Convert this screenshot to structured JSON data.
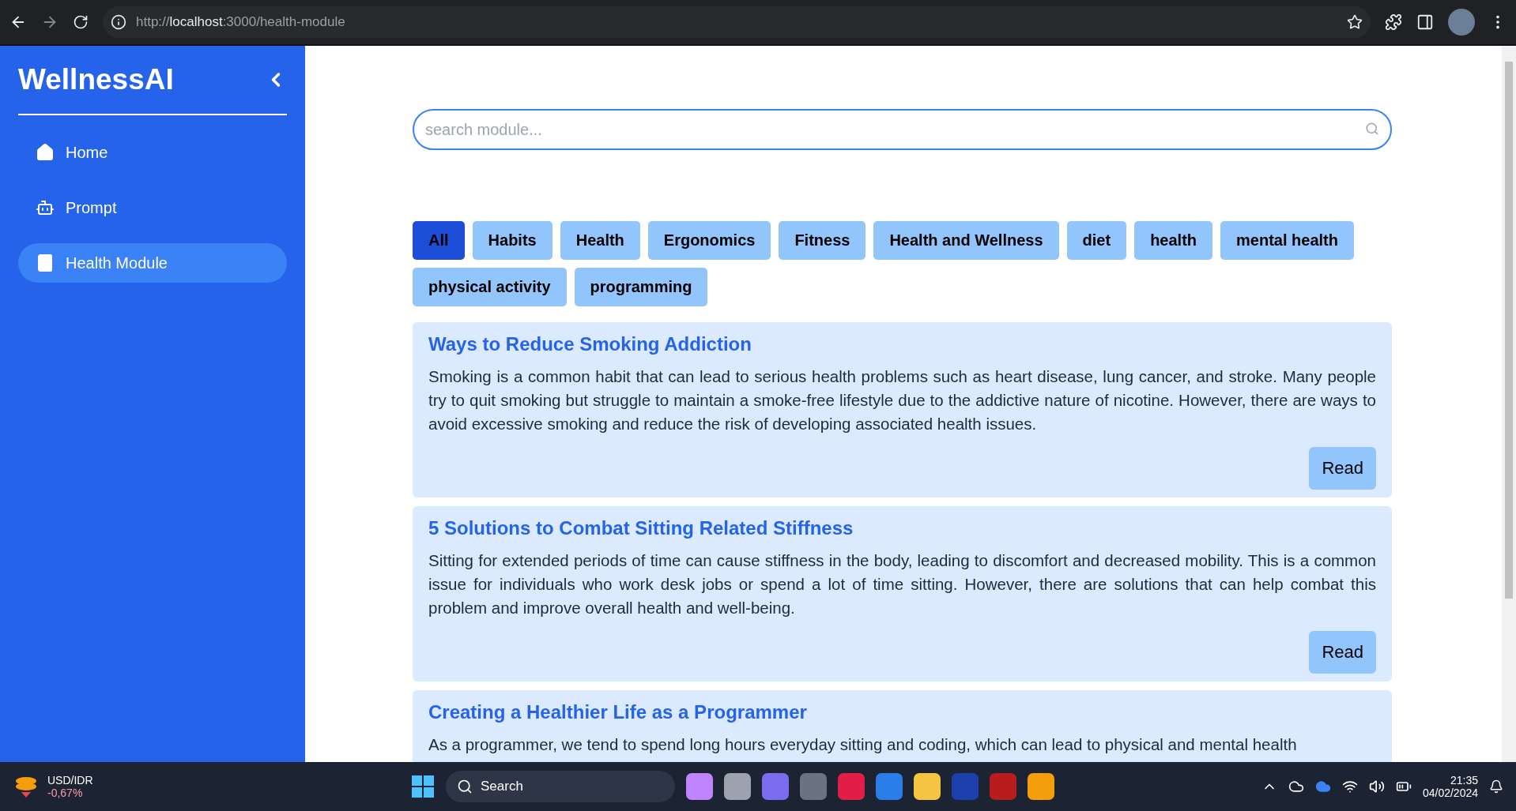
{
  "browser": {
    "url": {
      "scheme": "http://",
      "host": "localhost",
      "path": ":3000/health-module"
    }
  },
  "sidebar": {
    "title": "WellnessAI",
    "items": [
      {
        "label": "Home",
        "selected": false
      },
      {
        "label": "Prompt",
        "selected": false
      },
      {
        "label": "Health Module",
        "selected": true
      }
    ]
  },
  "search": {
    "placeholder": "search module..."
  },
  "tags": [
    {
      "label": "All",
      "selected": true
    },
    {
      "label": "Habits",
      "selected": false
    },
    {
      "label": "Health",
      "selected": false
    },
    {
      "label": "Ergonomics",
      "selected": false
    },
    {
      "label": "Fitness",
      "selected": false
    },
    {
      "label": "Health and Wellness",
      "selected": false
    },
    {
      "label": "diet",
      "selected": false
    },
    {
      "label": "health",
      "selected": false
    },
    {
      "label": "mental health",
      "selected": false
    },
    {
      "label": "physical activity",
      "selected": false
    },
    {
      "label": "programming",
      "selected": false
    }
  ],
  "modules": [
    {
      "title": "Ways to Reduce Smoking Addiction",
      "description": "Smoking is a common habit that can lead to serious health problems such as heart disease, lung cancer, and stroke. Many people try to quit smoking but struggle to maintain a smoke-free lifestyle due to the addictive nature of nicotine. However, there are ways to avoid excessive smoking and reduce the risk of developing associated health issues.",
      "button": "Read"
    },
    {
      "title": "5 Solutions to Combat Sitting Related Stiffness",
      "description": "Sitting for extended periods of time can cause stiffness in the body, leading to discomfort and decreased mobility. This is a common issue for individuals who work desk jobs or spend a lot of time sitting. However, there are solutions that can help combat this problem and improve overall health and well-being.",
      "button": "Read"
    },
    {
      "title": "Creating a Healthier Life as a Programmer",
      "description": "As a programmer, we tend to spend long hours everyday sitting and coding, which can lead to physical and mental health"
    }
  ],
  "taskbar": {
    "ticker": {
      "pair": "USD/IDR",
      "change": "-0,67%"
    },
    "search": "Search",
    "time": "21:35",
    "date": "04/02/2024"
  }
}
